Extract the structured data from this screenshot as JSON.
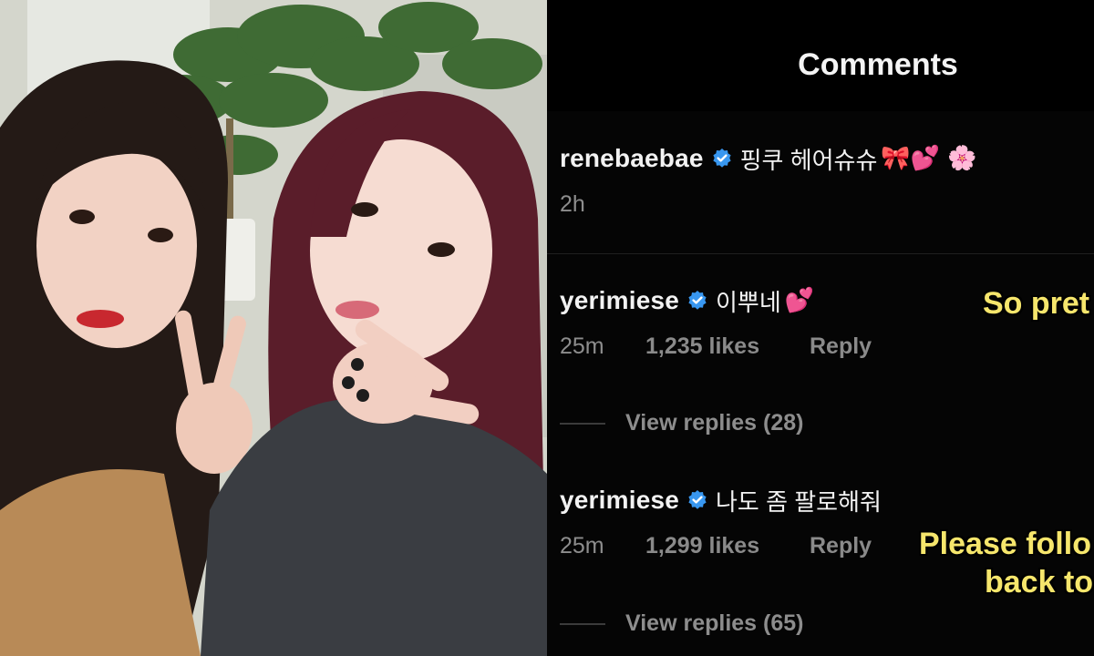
{
  "header": {
    "title": "Comments"
  },
  "comments": [
    {
      "username": "renebaebae",
      "verified": true,
      "text": "핑쿠 헤어슈슈",
      "emoji": "🎀💕 🌸",
      "time": "2h",
      "likes": "",
      "reply_label": ""
    },
    {
      "username": "yerimiese",
      "verified": true,
      "text": "이뿌네",
      "emoji": "💕",
      "time": "25m",
      "likes": "1,235 likes",
      "reply_label": "Reply",
      "view_replies": "View replies (28)",
      "caption": "So pret"
    },
    {
      "username": "yerimiese",
      "verified": true,
      "text": "나도 좀 팔로해줘",
      "emoji": "",
      "time": "25m",
      "likes": "1,299 likes",
      "reply_label": "Reply",
      "view_replies": "View replies (65)",
      "caption_line1": "Please follo",
      "caption_line2": "back to"
    }
  ],
  "colors": {
    "background": "#050505",
    "text_primary": "#f2f2f2",
    "text_secondary": "#8d8d8d",
    "verified_badge": "#3897f0",
    "caption_yellow": "#f6e66c"
  },
  "icons": {
    "verified": "verified-badge-icon"
  }
}
